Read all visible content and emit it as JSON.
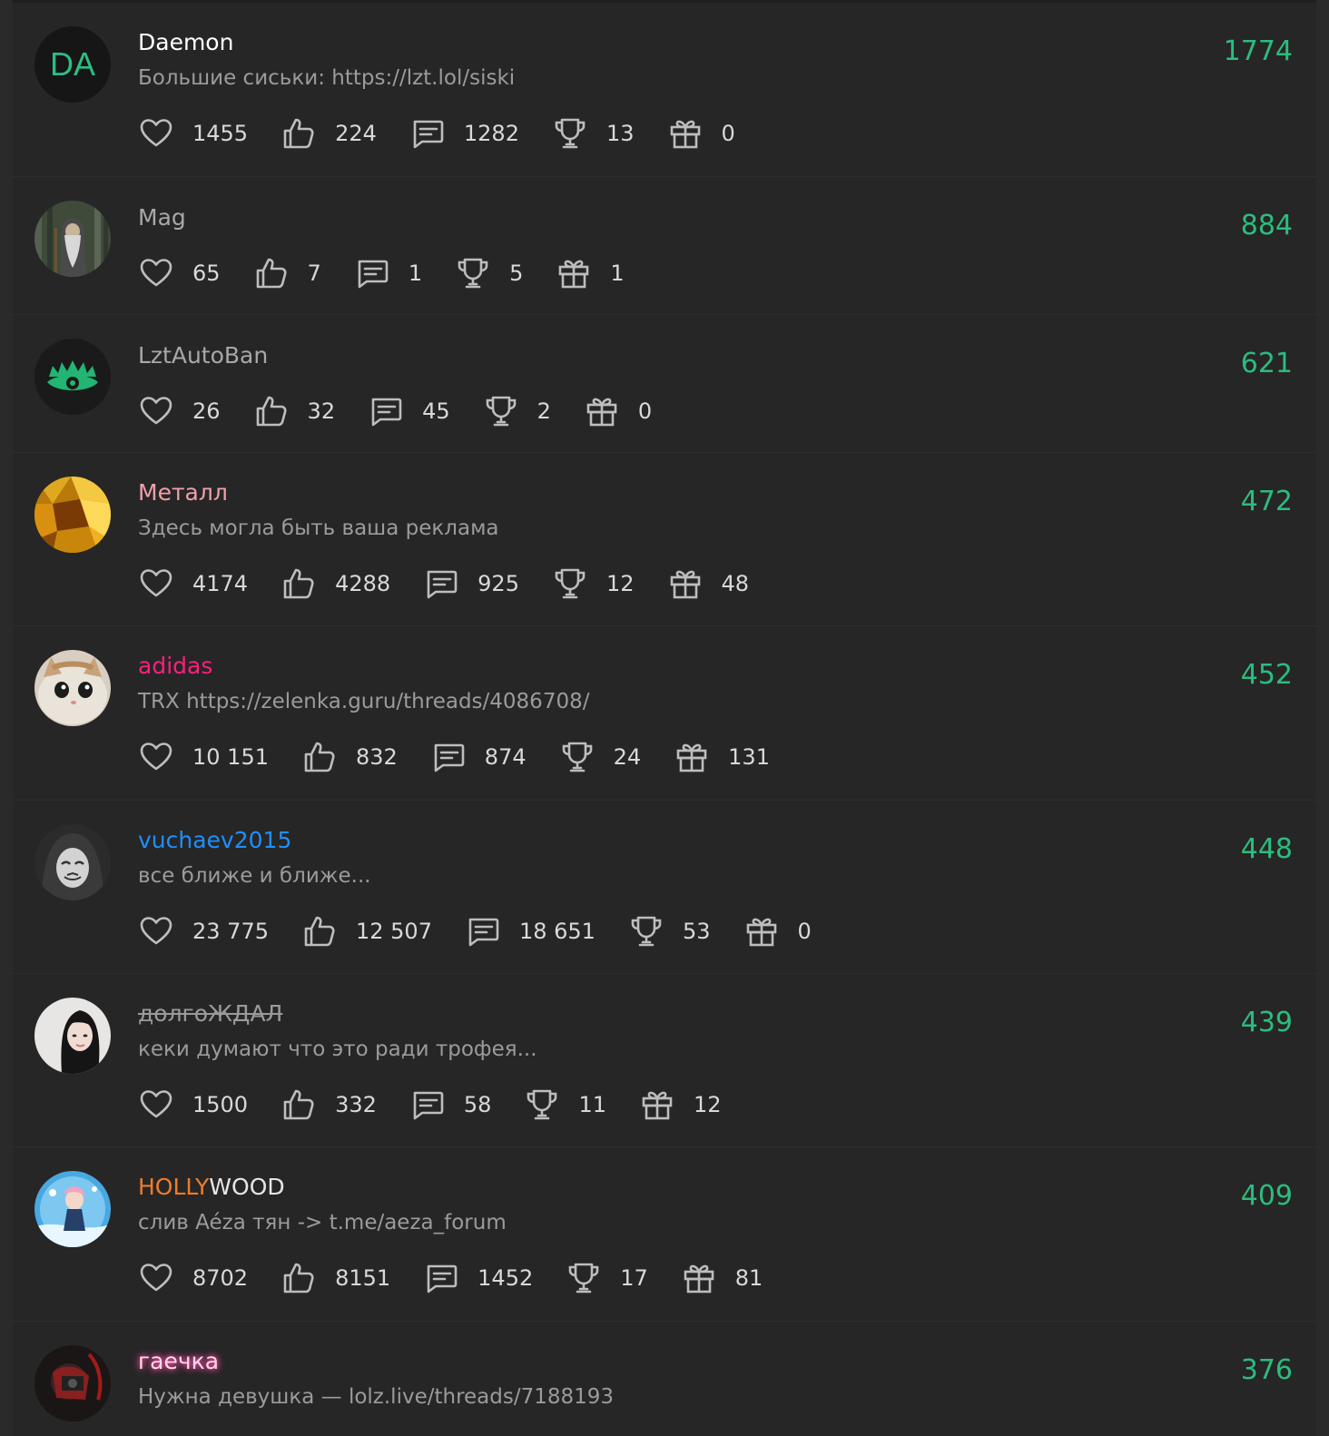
{
  "users": [
    {
      "name": "Daemon",
      "status": "Большие сиськи: https://lzt.lol/siski",
      "likes": "1455",
      "thumbs": "224",
      "messages": "1282",
      "trophies": "13",
      "gifts": "0",
      "score": "1774",
      "name_color": "#ffffff",
      "avatar": "initials",
      "initials": "DA"
    },
    {
      "name": "Mag",
      "status": "",
      "likes": "65",
      "thumbs": "7",
      "messages": "1",
      "trophies": "5",
      "gifts": "1",
      "score": "884",
      "name_color": "#a8a8a8",
      "avatar": "wizard"
    },
    {
      "name": "LztAutoBan",
      "status": "",
      "likes": "26",
      "thumbs": "32",
      "messages": "45",
      "trophies": "2",
      "gifts": "0",
      "score": "621",
      "name_color": "#a8a8a8",
      "avatar": "eye"
    },
    {
      "name": "Металл",
      "status": "Здесь могла быть ваша реклама",
      "likes": "4174",
      "thumbs": "4288",
      "messages": "925",
      "trophies": "12",
      "gifts": "48",
      "score": "472",
      "name_color": "#f0a0a8",
      "avatar": "gold"
    },
    {
      "name": "adidas",
      "status": "TRX https://zelenka.guru/threads/4086708/",
      "likes": "10 151",
      "thumbs": "832",
      "messages": "874",
      "trophies": "24",
      "gifts": "131",
      "score": "452",
      "name_color": "#ff1f7a",
      "avatar": "cat"
    },
    {
      "name": "vuchaev2015",
      "status": "все ближе и ближе...",
      "likes": "23 775",
      "thumbs": "12 507",
      "messages": "18 651",
      "trophies": "53",
      "gifts": "0",
      "score": "448",
      "name_color": "#1e8fff",
      "avatar": "mask"
    },
    {
      "name": "долгоЖДАЛ",
      "status": "кеки думают что это ради трофея...",
      "likes": "1500",
      "thumbs": "332",
      "messages": "58",
      "trophies": "11",
      "gifts": "12",
      "score": "439",
      "name_color": "#9a9a9a",
      "avatar": "girl",
      "strike": true
    },
    {
      "name_part1": "HOLLY",
      "name_part2": "WOOD",
      "status": "слив Aéza тян -> t.me/aeza_forum",
      "likes": "8702",
      "thumbs": "8151",
      "messages": "1452",
      "trophies": "17",
      "gifts": "81",
      "score": "409",
      "name_color": "#f07c2c",
      "name_color2": "#e6e6e6",
      "avatar": "anime"
    },
    {
      "name": "гаечка",
      "status": "Нужна девушка — lolz.live/threads/7188193",
      "score": "376",
      "name_color": "#ffd6ec",
      "avatar": "dark"
    }
  ],
  "icons": {
    "like": "heart-icon",
    "thumb": "thumbs-up-icon",
    "message": "message-icon",
    "trophy": "trophy-icon",
    "gift": "gift-icon"
  },
  "colors": {
    "background": "#262626",
    "score": "#2bbd7e",
    "text": "#d9d9d9",
    "muted": "#9b9b9b"
  }
}
